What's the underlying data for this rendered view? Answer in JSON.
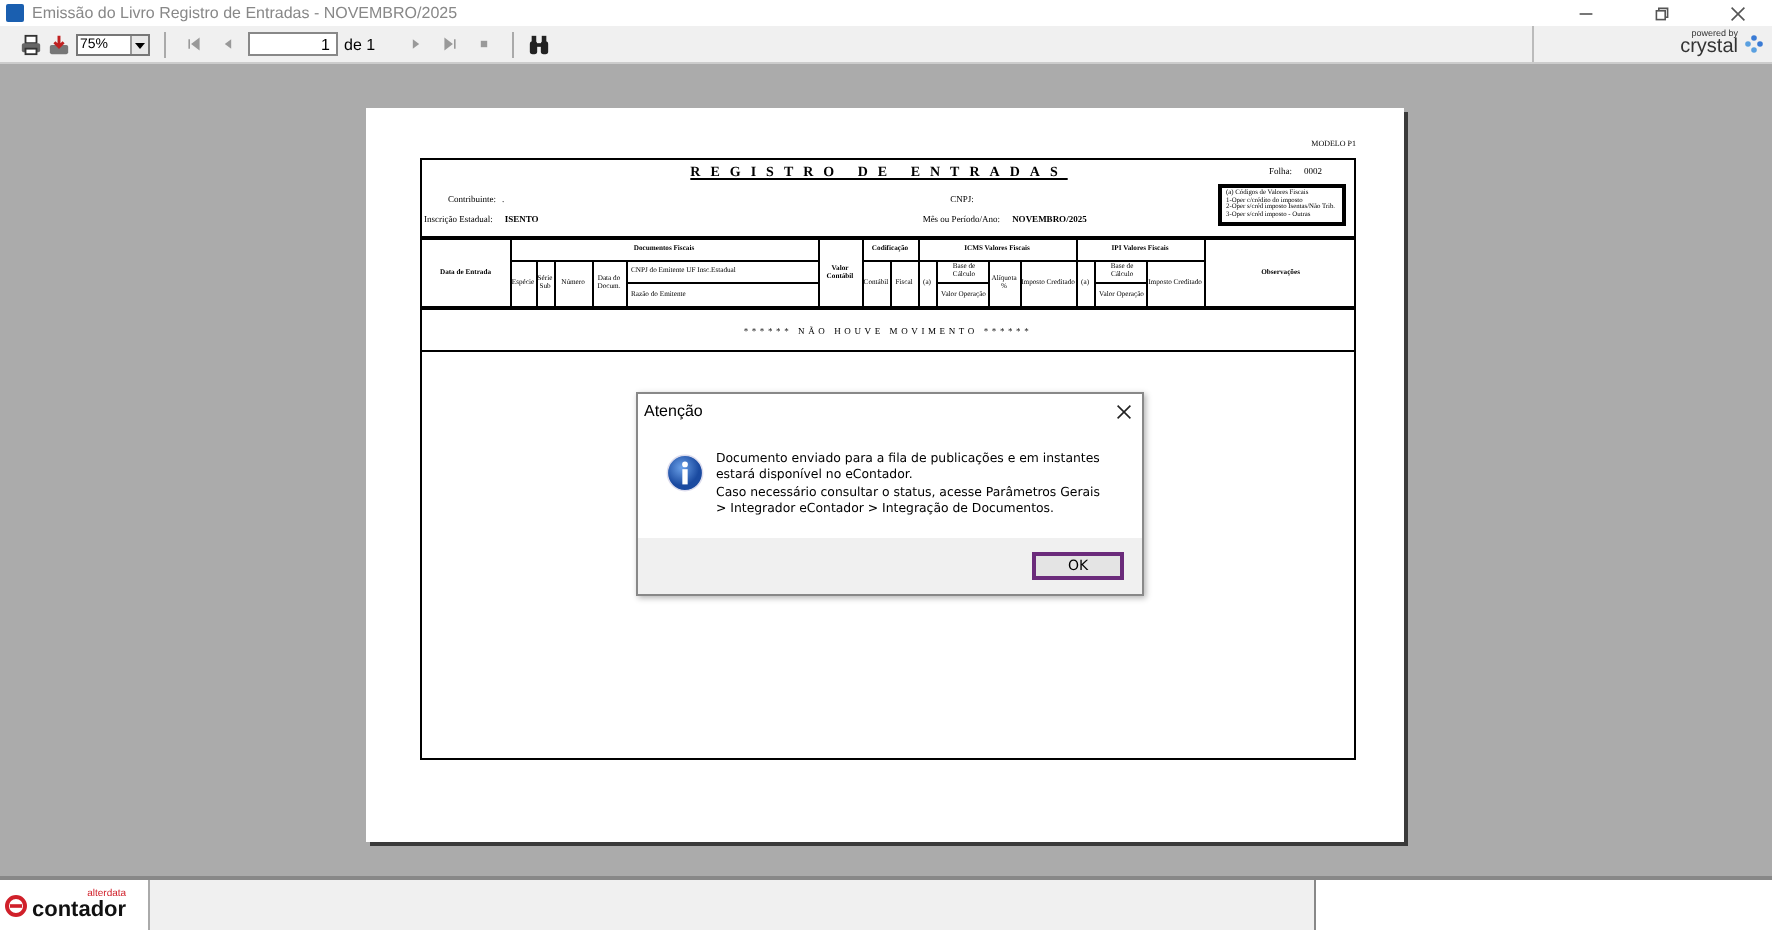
{
  "window": {
    "title": "Emissão do Livro Registro de Entradas - NOVEMBRO/2025"
  },
  "toolbar": {
    "zoom": "75%",
    "page": "1",
    "page_total": "de 1",
    "brand_small": "powered by",
    "brand": "crystal"
  },
  "report": {
    "model": "MODELO P1",
    "title": "REGISTRO DE ENTRADAS",
    "sheet_label": "Folha:",
    "sheet": "0002",
    "codes": [
      "(a) Códigos de Valores Fiscais",
      "1-Oper c/crédito do imposto",
      "2-Oper s/créd imposto Isentas/Não Trib.",
      "3-Oper s/créd imposto - Outras"
    ],
    "taxpayer_label": "Contribuinte:",
    "taxpayer": ".",
    "cnpj_label": "CNPJ:",
    "ie_label": "Inscrição Estadual:",
    "ie": "ISENTO",
    "period_label": "Mês ou Período/Ano:",
    "period": "NOVEMBRO/2025",
    "columns": [
      {
        "label": "Data de Entrada"
      },
      {
        "label": "Documentos Fiscais",
        "children": [
          {
            "label": "Espécie"
          },
          {
            "label": "Série Sub"
          },
          {
            "label": "Número"
          },
          {
            "label": "Data do Docum."
          },
          {
            "kind": "stacked",
            "label": "CNPJ do Emitente    UF    Insc.Estadual",
            "label2": "Razão do Emitente"
          }
        ]
      },
      {
        "label": "Valor Contábil"
      },
      {
        "label": "Codificação",
        "children": [
          {
            "label": "Contábil"
          },
          {
            "label": "Fiscal"
          }
        ]
      },
      {
        "label": "ICMS Valores Fiscais",
        "children": [
          {
            "label": "(a)"
          },
          {
            "kind": "stacked",
            "label": "Base de Cálculo",
            "label2": "Valor Operação"
          },
          {
            "label": "Alíquota %"
          },
          {
            "label": "Imposto Creditado"
          }
        ]
      },
      {
        "label": "IPI Valores Fiscais",
        "children": [
          {
            "label": "(a)"
          },
          {
            "kind": "stacked",
            "label": "Base de Cálculo",
            "label2": "Valor Operação"
          },
          {
            "label": "Imposto Creditado"
          }
        ]
      },
      {
        "label": "Observações"
      }
    ],
    "message": "****** NÃO HOUVE MOVIMENTO ******"
  },
  "dialog": {
    "title": "Atenção",
    "message": "Documento enviado para a fila de publicações e em instantes\nestará disponível no eContador.\nCaso necessário consultar o status, acesse Parâmetros Gerais\n> Integrador eContador > Integração de Documentos.",
    "button": "OK"
  },
  "footer": {
    "brand_small": "alterdata",
    "brand": "contador"
  }
}
